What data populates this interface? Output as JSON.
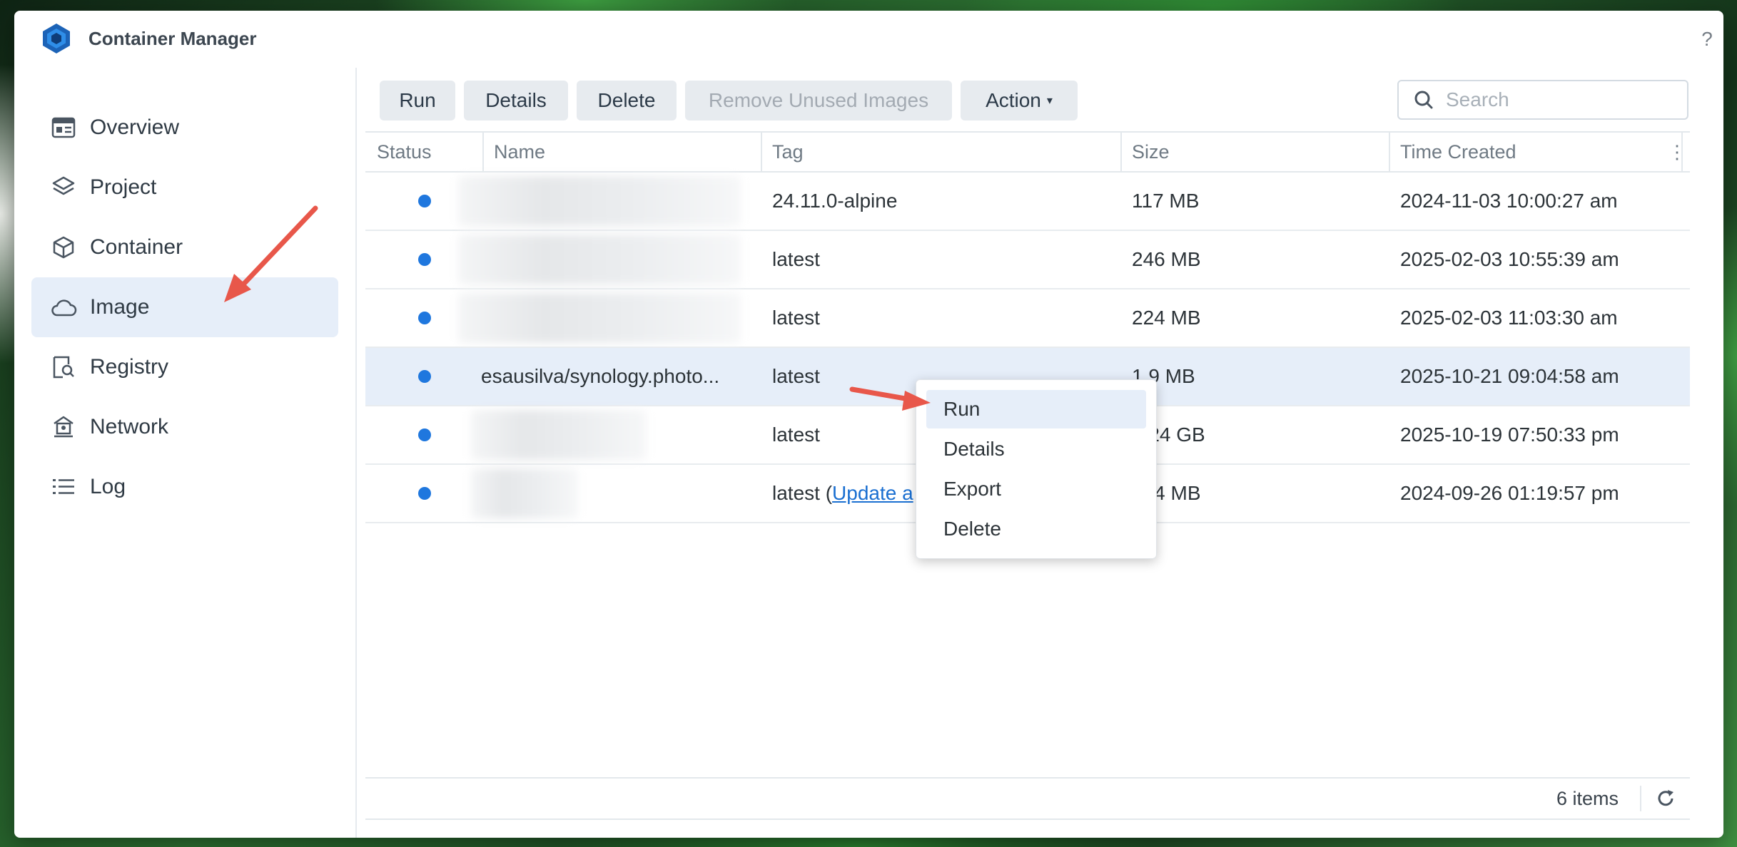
{
  "window": {
    "title": "Container Manager",
    "controls": [
      "?",
      "—",
      "☐",
      "✕"
    ]
  },
  "sidebar": {
    "items": [
      {
        "label": "Overview",
        "icon": "overview-icon"
      },
      {
        "label": "Project",
        "icon": "layers-icon"
      },
      {
        "label": "Container",
        "icon": "cube-icon"
      },
      {
        "label": "Image",
        "icon": "cloud-icon",
        "active": true
      },
      {
        "label": "Registry",
        "icon": "registry-search-icon"
      },
      {
        "label": "Network",
        "icon": "network-icon"
      },
      {
        "label": "Log",
        "icon": "list-icon"
      }
    ]
  },
  "toolbar": {
    "run": "Run",
    "details": "Details",
    "delete": "Delete",
    "remove_unused": "Remove Unused Images",
    "action": "Action",
    "search_placeholder": "Search"
  },
  "table": {
    "columns": [
      "Status",
      "Name",
      "Tag",
      "Size",
      "Time Created"
    ],
    "rows": [
      {
        "name": "",
        "tag": "24.11.0-alpine",
        "size": "117 MB",
        "created": "2024-11-03 10:00:27 am"
      },
      {
        "name": "",
        "tag": "latest",
        "size": "246 MB",
        "created": "2025-02-03 10:55:39 am"
      },
      {
        "name": "",
        "tag": "latest",
        "size": "224 MB",
        "created": "2025-02-03 11:03:30 am"
      },
      {
        "name": "esausilva/synology.photo...",
        "tag": "latest",
        "size": "1.9 MB",
        "created": "2025-10-21 09:04:58 am",
        "selected": true
      },
      {
        "name": "",
        "tag": "latest",
        "size": "1.24 GB",
        "created": "2025-10-19 07:50:33 pm"
      },
      {
        "name": "",
        "tag": "latest (",
        "tag_link": "Update a",
        "size": "104 MB",
        "created": "2024-09-26 01:19:57 pm"
      }
    ],
    "footer_count": "6 items"
  },
  "context_menu": {
    "items": [
      "Run",
      "Details",
      "Export",
      "Delete"
    ]
  },
  "colors": {
    "accent": "#1f77de",
    "selected_bg": "#e6eef9",
    "annotation_arrow": "#e8574a"
  }
}
